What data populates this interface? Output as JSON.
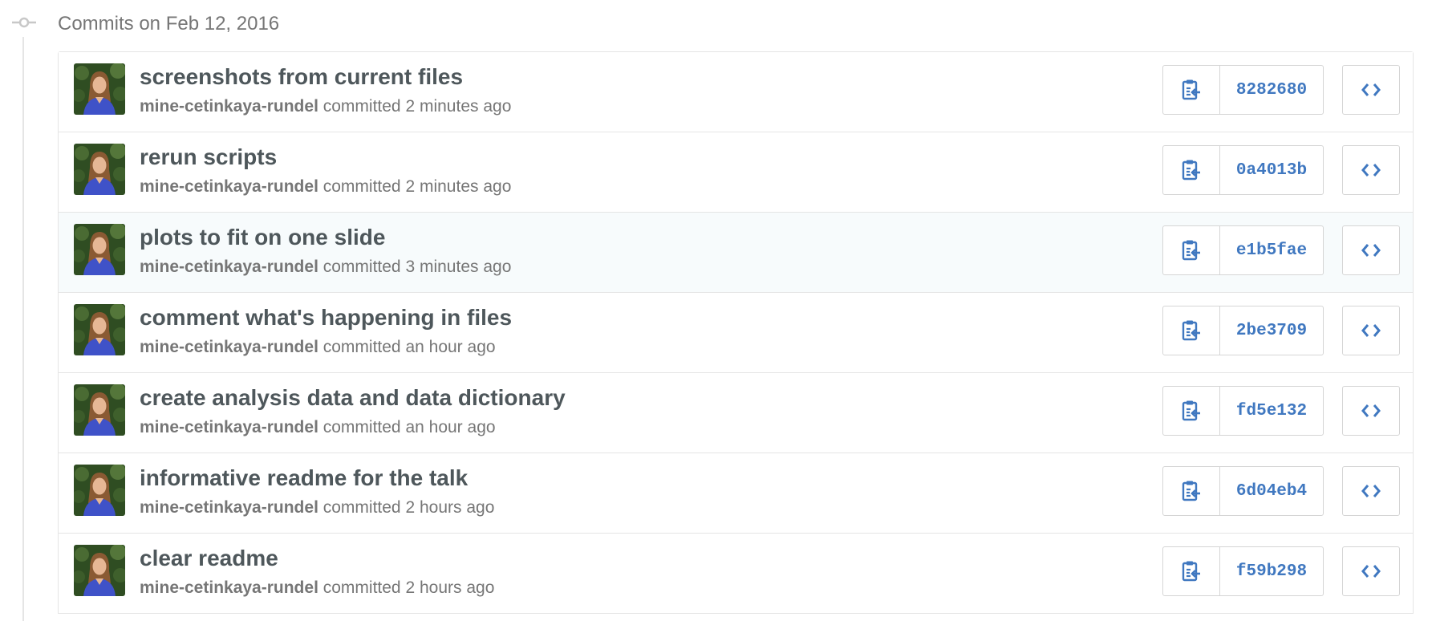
{
  "group": {
    "title": "Commits on Feb 12, 2016"
  },
  "colors": {
    "link": "#4078c0",
    "title": "#4e575b",
    "muted": "#767676",
    "border": "#e5e5e5",
    "highlight_row": "#f7fbfc"
  },
  "icons": {
    "timeline": "git-commit-icon",
    "copy": "clippy-icon",
    "browse": "code-icon"
  },
  "commits": [
    {
      "title": "screenshots from current files",
      "author": "mine-cetinkaya-rundel",
      "action": "committed",
      "time": "2 minutes ago",
      "sha": "8282680"
    },
    {
      "title": "rerun scripts",
      "author": "mine-cetinkaya-rundel",
      "action": "committed",
      "time": "2 minutes ago",
      "sha": "0a4013b"
    },
    {
      "title": "plots to fit on one slide",
      "author": "mine-cetinkaya-rundel",
      "action": "committed",
      "time": "3 minutes ago",
      "sha": "e1b5fae"
    },
    {
      "title": "comment what's happening in files",
      "author": "mine-cetinkaya-rundel",
      "action": "committed",
      "time": "an hour ago",
      "sha": "2be3709"
    },
    {
      "title": "create analysis data and data dictionary",
      "author": "mine-cetinkaya-rundel",
      "action": "committed",
      "time": "an hour ago",
      "sha": "fd5e132"
    },
    {
      "title": "informative readme for the talk",
      "author": "mine-cetinkaya-rundel",
      "action": "committed",
      "time": "2 hours ago",
      "sha": "6d04eb4"
    },
    {
      "title": "clear readme",
      "author": "mine-cetinkaya-rundel",
      "action": "committed",
      "time": "2 hours ago",
      "sha": "f59b298"
    }
  ]
}
